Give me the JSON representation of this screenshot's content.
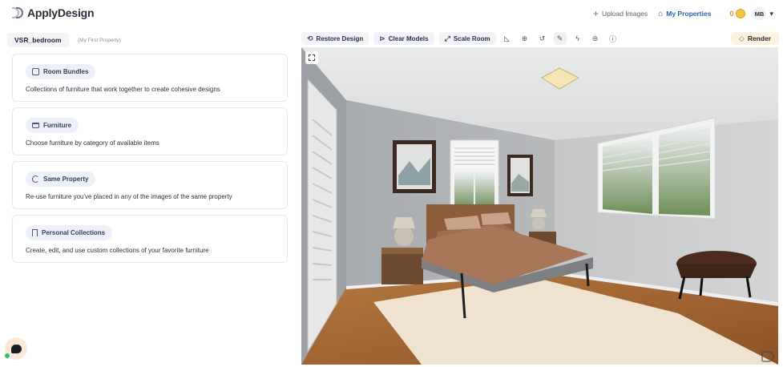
{
  "app": {
    "name": "ApplyDesign"
  },
  "header": {
    "upload_label": "Upload Images",
    "properties_label": "My Properties",
    "coins": "0",
    "user_initials": "MB"
  },
  "property": {
    "name": "VSR_bedroom",
    "subtitle": "(My First Property)"
  },
  "catalog": {
    "cards": [
      {
        "title": "Room Bundles",
        "icon": "cube-icon",
        "desc": "Collections of furniture that work together to create cohesive designs"
      },
      {
        "title": "Furniture",
        "icon": "sofa-icon",
        "desc": "Choose furniture by category of available items"
      },
      {
        "title": "Same Property",
        "icon": "recycle-icon",
        "desc": "Re-use furniture you've placed in any of the images of the same property"
      },
      {
        "title": "Personal Collections",
        "icon": "bookmark-icon",
        "desc": "Create, edit, and use custom collections of your favorite furniture"
      }
    ]
  },
  "toolbar": {
    "restore_label": "Restore Design",
    "clear_label": "Clear Models",
    "scale_label": "Scale Room",
    "tool_icons": [
      "ruler-icon",
      "zoom-icon",
      "undo-icon",
      "magic-icon",
      "lightning-icon",
      "settings-icon",
      "help-icon"
    ],
    "render_label": "Render"
  },
  "colors": {
    "accent_blue": "#2d5fa8",
    "coin_orange": "#e58c1b",
    "render_bg": "#fbf3df",
    "chip_bg": "#edf1f7"
  }
}
